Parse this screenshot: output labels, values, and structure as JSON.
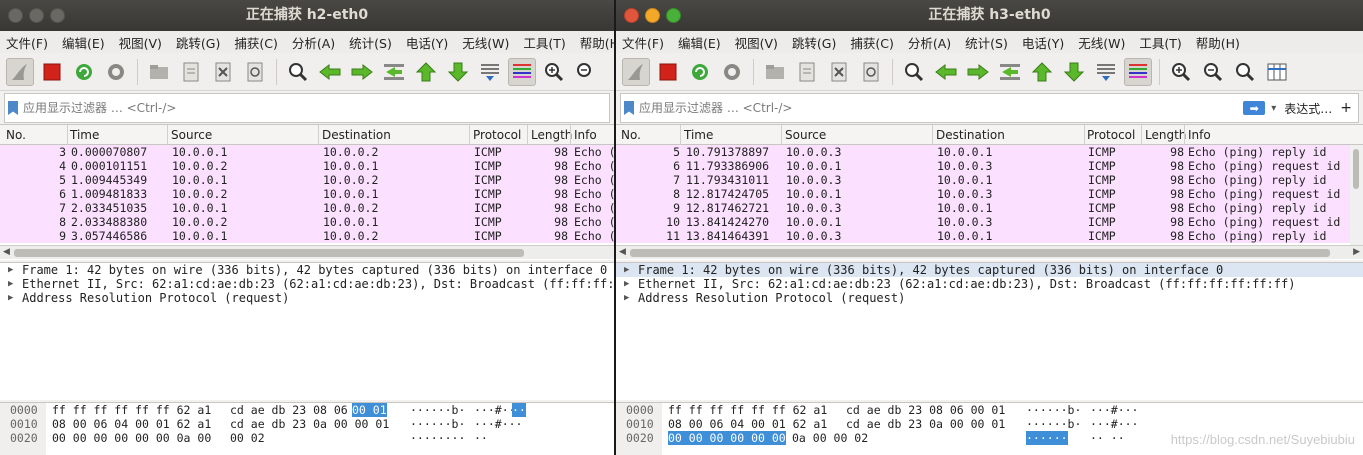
{
  "menu": [
    "文件(F)",
    "编辑(E)",
    "视图(V)",
    "跳转(G)",
    "捕获(C)",
    "分析(A)",
    "统计(S)",
    "电话(Y)",
    "无线(W)",
    "工具(T)",
    "帮助(H)"
  ],
  "filter": {
    "placeholder": "应用显示过滤器 … <Ctrl-/>",
    "expression_label": "表达式…",
    "plus": "+"
  },
  "columns": {
    "no": "No.",
    "time": "Time",
    "source": "Source",
    "destination": "Destination",
    "protocol": "Protocol",
    "length": "Length",
    "info": "Info"
  },
  "colors": {
    "row_bg": "#fce0ff",
    "highlight": "#3f8ed8",
    "titlebar": "#3d3b37"
  },
  "icons": [
    "shark-fin-icon",
    "stop-icon",
    "restart-icon",
    "options-gear-icon",
    "open-folder-icon",
    "save-file-icon",
    "close-file-icon",
    "reload-icon",
    "find-icon",
    "back-icon",
    "forward-icon",
    "goto-packet-icon",
    "first-packet-icon",
    "last-packet-icon",
    "autoscroll-icon",
    "colorize-icon",
    "zoom-in-icon",
    "zoom-out-icon",
    "zoom-normal-icon",
    "resize-columns-icon"
  ],
  "windows": [
    {
      "title": "正在捕获 h2-eth0",
      "packets": [
        {
          "no": "3",
          "time": "0.000070807",
          "src": "10.0.0.1",
          "dst": "10.0.0.2",
          "proto": "ICMP",
          "len": "98",
          "info": "Echo ("
        },
        {
          "no": "4",
          "time": "0.000101151",
          "src": "10.0.0.2",
          "dst": "10.0.0.1",
          "proto": "ICMP",
          "len": "98",
          "info": "Echo ("
        },
        {
          "no": "5",
          "time": "1.009445349",
          "src": "10.0.0.1",
          "dst": "10.0.0.2",
          "proto": "ICMP",
          "len": "98",
          "info": "Echo ("
        },
        {
          "no": "6",
          "time": "1.009481833",
          "src": "10.0.0.2",
          "dst": "10.0.0.1",
          "proto": "ICMP",
          "len": "98",
          "info": "Echo ("
        },
        {
          "no": "7",
          "time": "2.033451035",
          "src": "10.0.0.1",
          "dst": "10.0.0.2",
          "proto": "ICMP",
          "len": "98",
          "info": "Echo ("
        },
        {
          "no": "8",
          "time": "2.033488380",
          "src": "10.0.0.2",
          "dst": "10.0.0.1",
          "proto": "ICMP",
          "len": "98",
          "info": "Echo ("
        },
        {
          "no": "9",
          "time": "3.057446586",
          "src": "10.0.0.1",
          "dst": "10.0.0.2",
          "proto": "ICMP",
          "len": "98",
          "info": "Echo ("
        }
      ],
      "details": [
        "Frame 1: 42 bytes on wire (336 bits), 42 bytes captured (336 bits) on interface 0",
        "Ethernet II, Src: 62:a1:cd:ae:db:23 (62:a1:cd:ae:db:23), Dst: Broadcast (ff:ff:ff:ff:ff:ff)",
        "Address Resolution Protocol (request)"
      ],
      "bytes": [
        {
          "offset": "0000",
          "hex1": "ff ff ff ff ff ff 62 a1",
          "hex2a": "cd ae db 23 08 06",
          "hex2b": "00 01",
          "asciiA": "······b·",
          "asciiB": " ···#··",
          "asciiC": "··"
        },
        {
          "offset": "0010",
          "hex1": "08 00 06 04 00 01 62 a1",
          "hex2a": "cd ae db 23 0a 00 00 01",
          "hex2b": "",
          "asciiA": "······b·",
          "asciiB": " ···#···",
          "asciiC": ""
        },
        {
          "offset": "0020",
          "hex1": "00 00 00 00 00 00 0a 00",
          "hex2a": "00 02",
          "hex2b": "",
          "asciiA": "········",
          "asciiB": " ··",
          "asciiC": ""
        }
      ]
    },
    {
      "title": "正在捕获 h3-eth0",
      "packets": [
        {
          "no": "5",
          "time": "10.791378897",
          "src": "10.0.0.3",
          "dst": "10.0.0.1",
          "proto": "ICMP",
          "len": "98",
          "info": "Echo (ping) reply    id"
        },
        {
          "no": "6",
          "time": "11.793386906",
          "src": "10.0.0.1",
          "dst": "10.0.0.3",
          "proto": "ICMP",
          "len": "98",
          "info": "Echo (ping) request  id"
        },
        {
          "no": "7",
          "time": "11.793431011",
          "src": "10.0.0.3",
          "dst": "10.0.0.1",
          "proto": "ICMP",
          "len": "98",
          "info": "Echo (ping) reply    id"
        },
        {
          "no": "8",
          "time": "12.817424705",
          "src": "10.0.0.1",
          "dst": "10.0.0.3",
          "proto": "ICMP",
          "len": "98",
          "info": "Echo (ping) request  id"
        },
        {
          "no": "9",
          "time": "12.817462721",
          "src": "10.0.0.3",
          "dst": "10.0.0.1",
          "proto": "ICMP",
          "len": "98",
          "info": "Echo (ping) reply    id"
        },
        {
          "no": "10",
          "time": "13.841424270",
          "src": "10.0.0.1",
          "dst": "10.0.0.3",
          "proto": "ICMP",
          "len": "98",
          "info": "Echo (ping) request  id"
        },
        {
          "no": "11",
          "time": "13.841464391",
          "src": "10.0.0.3",
          "dst": "10.0.0.1",
          "proto": "ICMP",
          "len": "98",
          "info": "Echo (ping) reply    id"
        }
      ],
      "details": [
        "Frame 1: 42 bytes on wire (336 bits), 42 bytes captured (336 bits) on interface 0",
        "Ethernet II, Src: 62:a1:cd:ae:db:23 (62:a1:cd:ae:db:23), Dst: Broadcast (ff:ff:ff:ff:ff:ff)",
        "Address Resolution Protocol (request)"
      ],
      "bytes": [
        {
          "offset": "0000",
          "hex1": "ff ff ff ff ff ff 62 a1",
          "hex2a": "cd ae db 23 08 06 00 01",
          "hex2b": "",
          "asciiA": "······b·",
          "asciiB": " ···#···",
          "asciiC": ""
        },
        {
          "offset": "0010",
          "hex1": "08 00 06 04 00 01 62 a1",
          "hex2a": "cd ae db 23 0a 00 00 01",
          "hex2b": "",
          "asciiA": "······b·",
          "asciiB": " ···#···",
          "asciiC": ""
        },
        {
          "offset": "0020",
          "hex1": "00 00 00 00 00 00",
          "hex2a": "0a 00  00 02",
          "hex2b": "",
          "asciiA": "······",
          "asciiB": "·· ··",
          "asciiC": ""
        }
      ],
      "watermark": "https://blog.csdn.net/Suyebiubiu"
    }
  ]
}
